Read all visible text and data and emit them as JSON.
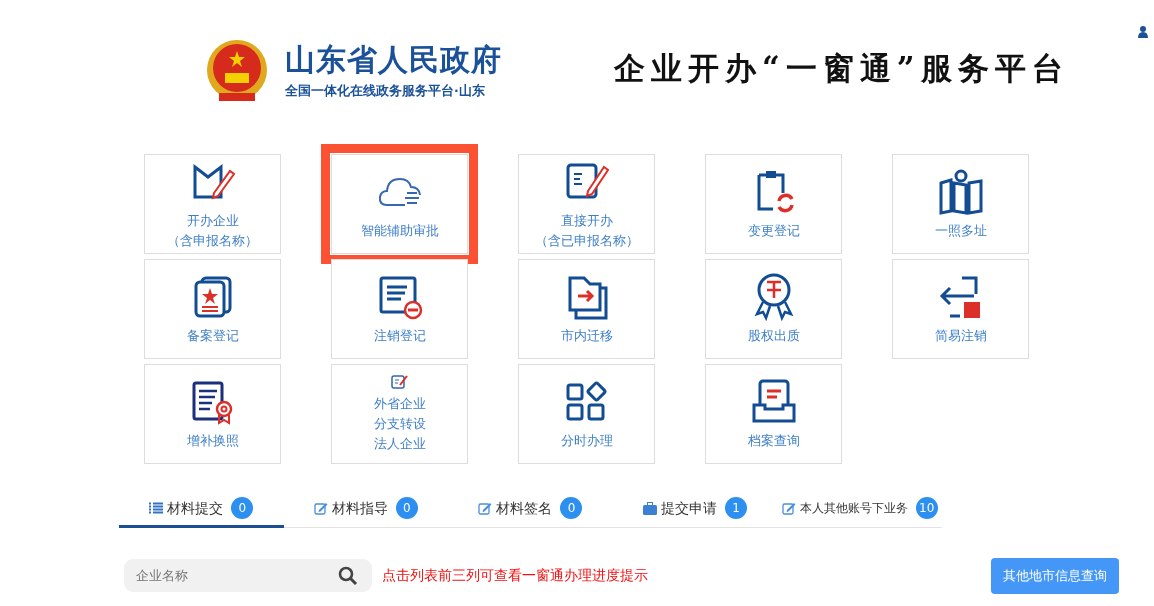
{
  "header": {
    "title": "山东省人民政府",
    "subtitle": "全国一体化在线政务服务平台·山东",
    "platform_title": "企业开办“一窗通”服务平台"
  },
  "services": [
    {
      "lines": [
        "开办企业",
        "（含申报名称）"
      ],
      "highlighted": false
    },
    {
      "lines": [
        "智能辅助审批"
      ],
      "highlighted": true
    },
    {
      "lines": [
        "直接开办",
        "（含已申报名称）"
      ],
      "highlighted": false
    },
    {
      "lines": [
        "变更登记"
      ],
      "highlighted": false
    },
    {
      "lines": [
        "一照多址"
      ],
      "highlighted": false
    },
    {
      "lines": [
        "备案登记"
      ],
      "highlighted": false
    },
    {
      "lines": [
        "注销登记"
      ],
      "highlighted": false
    },
    {
      "lines": [
        "市内迁移"
      ],
      "highlighted": false
    },
    {
      "lines": [
        "股权出质"
      ],
      "highlighted": false
    },
    {
      "lines": [
        "简易注销"
      ],
      "highlighted": false
    },
    {
      "lines": [
        "增补换照"
      ],
      "highlighted": false
    },
    {
      "lines": [
        "外省企业",
        "分支转设",
        "法人企业"
      ],
      "highlighted": false
    },
    {
      "lines": [
        "分时办理"
      ],
      "highlighted": false
    },
    {
      "lines": [
        "档案查询"
      ],
      "highlighted": false
    }
  ],
  "tabs": [
    {
      "label": "材料提交",
      "count": "0",
      "selected": true,
      "kind": "list"
    },
    {
      "label": "材料指导",
      "count": "0",
      "selected": false,
      "kind": "edit"
    },
    {
      "label": "材料签名",
      "count": "0",
      "selected": false,
      "kind": "edit"
    },
    {
      "label": "提交申请",
      "count": "1",
      "selected": false,
      "kind": "briefcase"
    },
    {
      "label": "本人其他账号下业务",
      "count": "10",
      "selected": false,
      "kind": "edit"
    }
  ],
  "search": {
    "placeholder": "企业名称"
  },
  "hint": "点击列表前三列可查看一窗通办理进度提示",
  "query_button": "其他地市信息查询"
}
